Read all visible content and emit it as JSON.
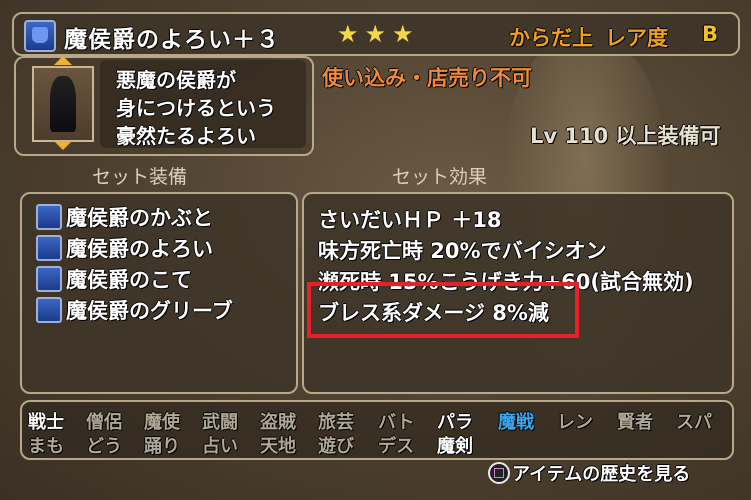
{
  "header": {
    "item_name": "魔侯爵のよろい＋３",
    "stars": "★★★",
    "slot": "からだ上",
    "rarity_label": "レア度",
    "rarity_grade": "B"
  },
  "description": {
    "lines": [
      "悪魔の侯爵が",
      "身につけるという",
      "豪然たるよろい"
    ],
    "restriction": "使い込み・店売り不可",
    "level_requirement": "Lv 110 以上装備可"
  },
  "sections": {
    "set_equipment_title": "セット装備",
    "set_effect_title": "セット効果"
  },
  "set_items": [
    {
      "label": "魔侯爵のかぶと",
      "icon": "helmet-icon"
    },
    {
      "label": "魔侯爵のよろい",
      "icon": "armor-icon"
    },
    {
      "label": "魔侯爵のこて",
      "icon": "gauntlet-icon"
    },
    {
      "label": "魔侯爵のグリーブ",
      "icon": "greaves-icon"
    }
  ],
  "set_effects": [
    "さいだいＨＰ ＋18",
    "味方死亡時 20%でバイシオン",
    "瀕死時 15%こうげき力+60(試合無効)",
    "ブレス系ダメージ 8%減"
  ],
  "jobs_row1": [
    {
      "label": "戦士",
      "state": "on"
    },
    {
      "label": "僧侶",
      "state": "dim"
    },
    {
      "label": "魔使",
      "state": "dim"
    },
    {
      "label": "武闘",
      "state": "dim"
    },
    {
      "label": "盗賊",
      "state": "dim"
    },
    {
      "label": "旅芸",
      "state": "dim"
    },
    {
      "label": "バト",
      "state": "dim"
    },
    {
      "label": "パラ",
      "state": "on"
    },
    {
      "label": "魔戦",
      "state": "sel"
    },
    {
      "label": "レン",
      "state": "dim"
    },
    {
      "label": "賢者",
      "state": "dim"
    },
    {
      "label": "スパ",
      "state": "dim"
    }
  ],
  "jobs_row2": [
    {
      "label": "まも",
      "state": "dim"
    },
    {
      "label": "どう",
      "state": "dim"
    },
    {
      "label": "踊り",
      "state": "dim"
    },
    {
      "label": "占い",
      "state": "dim"
    },
    {
      "label": "天地",
      "state": "dim"
    },
    {
      "label": "遊び",
      "state": "dim"
    },
    {
      "label": "デス",
      "state": "dim"
    },
    {
      "label": "魔剣",
      "state": "on"
    }
  ],
  "footer": {
    "history_label": "アイテムの歴史を見る",
    "button_icon": "square-button-icon"
  },
  "colors": {
    "orange": "#f0a020",
    "selected_job": "#38a8f0",
    "highlight": "#e8202a"
  }
}
